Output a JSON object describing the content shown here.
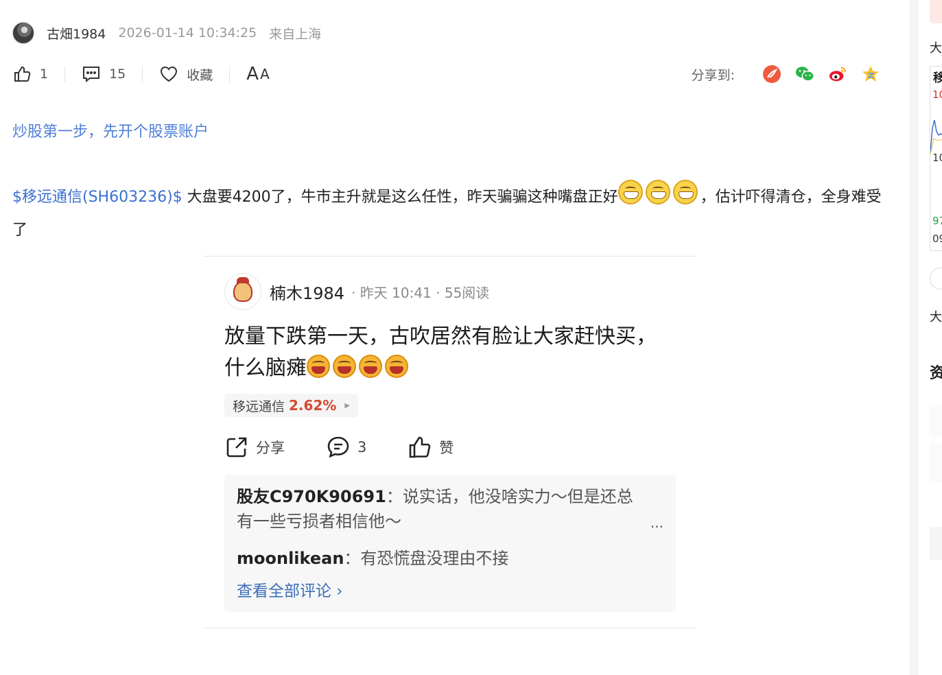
{
  "author": {
    "name": "古畑1984",
    "time": "2026-01-14 10:34:25",
    "source": "来自上海"
  },
  "actions": {
    "like_count": "1",
    "comment_count": "15",
    "favorite_label": "收藏",
    "font_label_big": "A",
    "font_label_small": "A"
  },
  "share": {
    "label": "分享到:",
    "icons": [
      "xueqiu-icon",
      "wechat-icon",
      "weibo-icon",
      "qzone-icon"
    ]
  },
  "promo_link": "炒股第一步，先开个股票账户",
  "post": {
    "stock_tag": "$移远通信(SH603236)$",
    "text_before_emoji": " 大盘要4200了，牛市主升就是这么任性，昨天骗骗这种嘴盘正好",
    "text_after_emoji": "，估计吓得清仓，全身难受了"
  },
  "embed": {
    "author": "楠木1984",
    "meta": "· 昨天 10:41 · 55阅读",
    "text": "放量下跌第一天，古吹居然有脸让大家赶快买，什么脑瘫",
    "stock_name": "移远通信",
    "stock_change": "2.62%",
    "share_label": "分享",
    "comment_count": "3",
    "like_label": "赞",
    "comments": [
      {
        "user": "股友C970K90691",
        "sep": "：",
        "text": "说实话，他没啥实力～但是还总有一些亏损者相信他～"
      },
      {
        "user": "moonlikean",
        "sep": "：",
        "text": "有恐慌盘没理由不接"
      }
    ],
    "more": "...",
    "view_all": "查看全部评论 ›"
  },
  "sidebar": {
    "t1": "大",
    "t2": "移",
    "tick1": "10",
    "tick2": "10",
    "tick3": "97",
    "tick4": "09",
    "t3": "大",
    "t4": "资"
  },
  "colors": {
    "link_blue": "#4e7fd6",
    "stock_red": "#d24a2f",
    "comment_link": "#3c6eb8"
  }
}
